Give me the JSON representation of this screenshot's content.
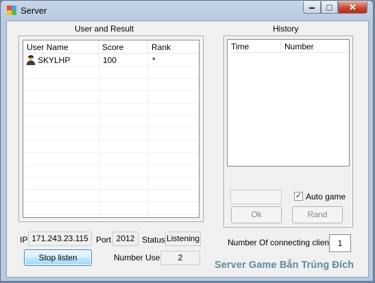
{
  "window": {
    "title": "Server",
    "controls": {
      "minimize": "▬",
      "maximize": "▢",
      "close": "✕"
    }
  },
  "users_panel": {
    "title": "User and Result",
    "columns": [
      "User Name",
      "Score",
      "Rank"
    ],
    "rows": [
      {
        "user": "SKYLHP",
        "score": "100",
        "rank": "*",
        "icon": "user-avatar-icon"
      }
    ]
  },
  "history_panel": {
    "title": "History",
    "columns": [
      "Time",
      "Number"
    ],
    "input_value": "",
    "auto_game_label": "Auto game",
    "auto_game_checked": true,
    "ok_label": "Ok",
    "rand_label": "Rand",
    "connecting_label": "Number Of connecting clients",
    "connecting_count": "1"
  },
  "status_bar": {
    "ip_label": "IP",
    "ip_value": "171.243.23.115",
    "port_label": "Port",
    "port_value": "2012",
    "status_label": "Status",
    "status_value": "Listening",
    "stop_button": "Stop listen",
    "users_label": "Number Users",
    "users_value": "2"
  },
  "footer_text": "Server Game Bắn Trúng Đích",
  "colors": {
    "footer_text": "#5f8aa2",
    "close_button": "#c8432f",
    "title_bar": "#c7d6e8"
  }
}
